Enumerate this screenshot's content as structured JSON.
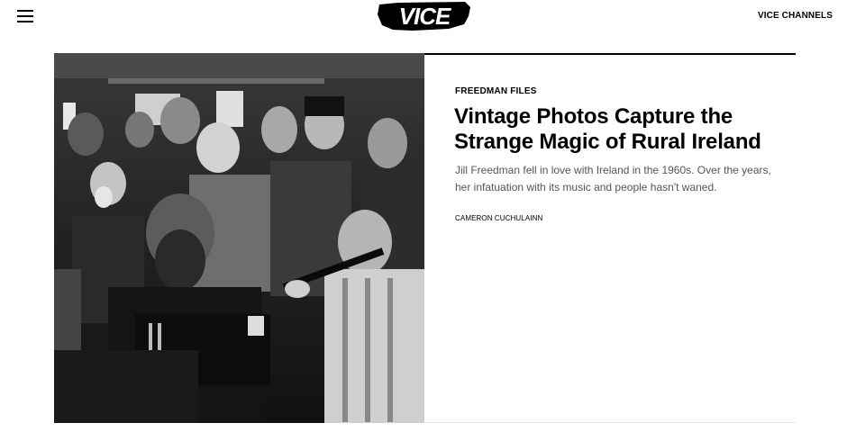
{
  "header": {
    "logo_text": "VICE",
    "menu_icon": "hamburger-menu-icon",
    "channels_label": "VICE CHANNELS"
  },
  "article": {
    "kicker": "FREEDMAN FILES",
    "headline": "Vintage Photos Capture the Strange Magic of Rural Ireland",
    "dek": "Jill Freedman fell in love with Ireland in the 1960s. Over the years, her infatuation with its music and people hasn't waned.",
    "byline": "CAMERON CUCHULAINN",
    "image_alt": "Black and white photo of musicians playing accordion and tin whistle in a crowded pub"
  }
}
